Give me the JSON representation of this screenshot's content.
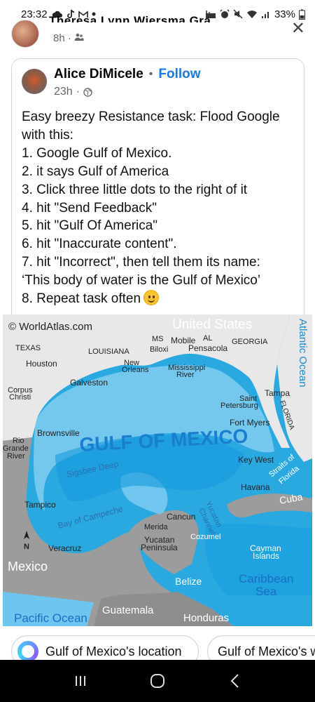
{
  "status_bar": {
    "time": "23:32",
    "left_icons": [
      "cloud-icon",
      "tiktok-icon",
      "gmail-icon",
      "dot-icon"
    ],
    "battery": "33%"
  },
  "prev_post": {
    "name_partial": "Theresa Lynn Wiersma Gra...",
    "time": "8h"
  },
  "shared_post": {
    "author": "Alice DiMicele",
    "follow": "Follow",
    "time": "23h",
    "lines": [
      "Easy breezy Resistance task: Flood Google",
      "with this:",
      "1. Google Gulf of Mexico.",
      "2. it says Gulf of America",
      "3. Click three little dots to the right of it",
      "4. hit \"Send Feedback\"",
      "5. hit \"Gulf Of America\"",
      "6. hit \"Inaccurate content\".",
      "7. hit \"Incorrect\", then tell them its name:",
      "‘This body of water is the Gulf of Mexico’",
      "8. Repeat task often"
    ]
  },
  "map": {
    "watermark": "© WorldAtlas.com",
    "title": "GULF OF MEXICO",
    "labels": {
      "united_states": "United States",
      "atlantic": "Atlantic Ocean",
      "texas": "TEXAS",
      "louisiana": "LOUISIANA",
      "ms": "MS",
      "al": "AL",
      "georgia": "GEORGIA",
      "mobile": "Mobile",
      "biloxi": "Biloxi",
      "pensacola": "Pensacola",
      "houston": "Houston",
      "new_orleans_1": "New",
      "new_orleans_2": "Orleans",
      "mississippi_1": "Mississippi",
      "mississippi_2": "River",
      "galveston": "Galveston",
      "corpus_1": "Corpus",
      "corpus_2": "Christi",
      "tampa": "Tampa",
      "st_pete_1": "Saint",
      "st_pete_2": "Petersburg",
      "florida": "FLORIDA",
      "fort_myers": "Fort Myers",
      "brownsville": "Brownsville",
      "rio_1": "Rio",
      "rio_2": "Grande",
      "rio_3": "River",
      "sigsbee": "Sigsbee Deep",
      "key_west": "Key West",
      "straits_1": "Straits of",
      "straits_2": "Florida",
      "havana": "Havana",
      "cuba": "Cuba",
      "tampico": "Tampico",
      "cancun": "Cancun",
      "merida": "Merida",
      "yucatan_channel_1": "Yucatan",
      "yucatan_channel_2": "Channel",
      "campeche": "Bay of Campeche",
      "yucatan_pen_1": "Yucatan",
      "yucatan_pen_2": "Peninsula",
      "cozumel": "Cozumel",
      "veracruz": "Veracruz",
      "compass_n": "N",
      "mexico": "Mexico",
      "cayman_1": "Cayman",
      "cayman_2": "Islands",
      "belize": "Belize",
      "caribbean_1": "Caribbean",
      "caribbean_2": "Sea",
      "guatemala": "Guatemala",
      "pacific": "Pacific Ocean",
      "honduras": "Honduras"
    }
  },
  "search_chips": [
    {
      "label": "Gulf of Mexico's location"
    },
    {
      "label": "Gulf of Mexico's w"
    }
  ],
  "colors": {
    "follow": "#1877f2",
    "deep_water": "#1aa3e6",
    "shelf_water": "#6cc6f0",
    "land": "#e6e6e6",
    "mexico_land": "#9b9b9b"
  }
}
